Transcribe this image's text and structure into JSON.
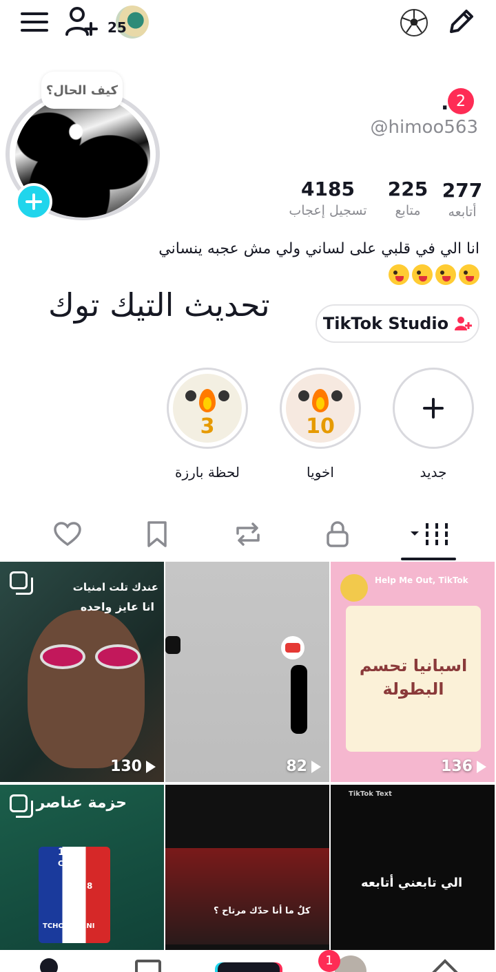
{
  "topbar": {
    "menu_icon": "hamburger-menu-icon",
    "add_friend_icon": "add-person-icon",
    "friend_count": "25",
    "soccer_icon": "soccer-ball-icon",
    "edit_icon": "pencil-icon"
  },
  "profile": {
    "avatar_bubble_text": "كيف الحال؟",
    "display_name": ".",
    "notification_count": "2",
    "username": "@himoo563",
    "stats": [
      {
        "value": "4185",
        "label": "تسجيل إعجاب"
      },
      {
        "value": "225",
        "label": "متابع"
      },
      {
        "value": "277",
        "label": "أتابعه"
      }
    ],
    "bio": "انا الي في قلبي على لساني ولي مش عجبه ينساني",
    "big_title": "تحديث التيك توك",
    "studio_button": "TikTok Studio"
  },
  "highlights": [
    {
      "label": "لحظة بارزة",
      "number": "3"
    },
    {
      "label": "اخويا",
      "number": "10"
    },
    {
      "label": "جديد",
      "number": ""
    }
  ],
  "tabs": [
    "liked",
    "favorites",
    "reposts",
    "private",
    "videos"
  ],
  "videos": [
    {
      "caption_line1": "عندك تلت امنيات",
      "caption_line2": "انا عايز واحده",
      "views": "130"
    },
    {
      "caption_line1": "",
      "caption_line2": "",
      "views": "82"
    },
    {
      "caption_line1": "Help Me Out, TikTok",
      "caption_line2": "اسبانيا تحسم البطولة",
      "views": "136"
    },
    {
      "caption_line1": "حزمة عناصر",
      "caption_line2": "TCHOUAMENI",
      "card_rating": "115",
      "card_pos": "CDM",
      "card_num": "8",
      "views": ""
    },
    {
      "caption_line1": "كلٌ ما أنا حدّك مرتاح ؟",
      "caption_line2": "",
      "views": ""
    },
    {
      "caption_line1": "TikTok Text",
      "caption_line2": "الي تابعني أتابعه",
      "views": ""
    }
  ],
  "bottom_nav": {
    "inbox_badge": "1"
  },
  "colors": {
    "accent": "#fe2c55",
    "cyan": "#20d5ec",
    "text": "#161823",
    "muted": "#8a8b91"
  }
}
